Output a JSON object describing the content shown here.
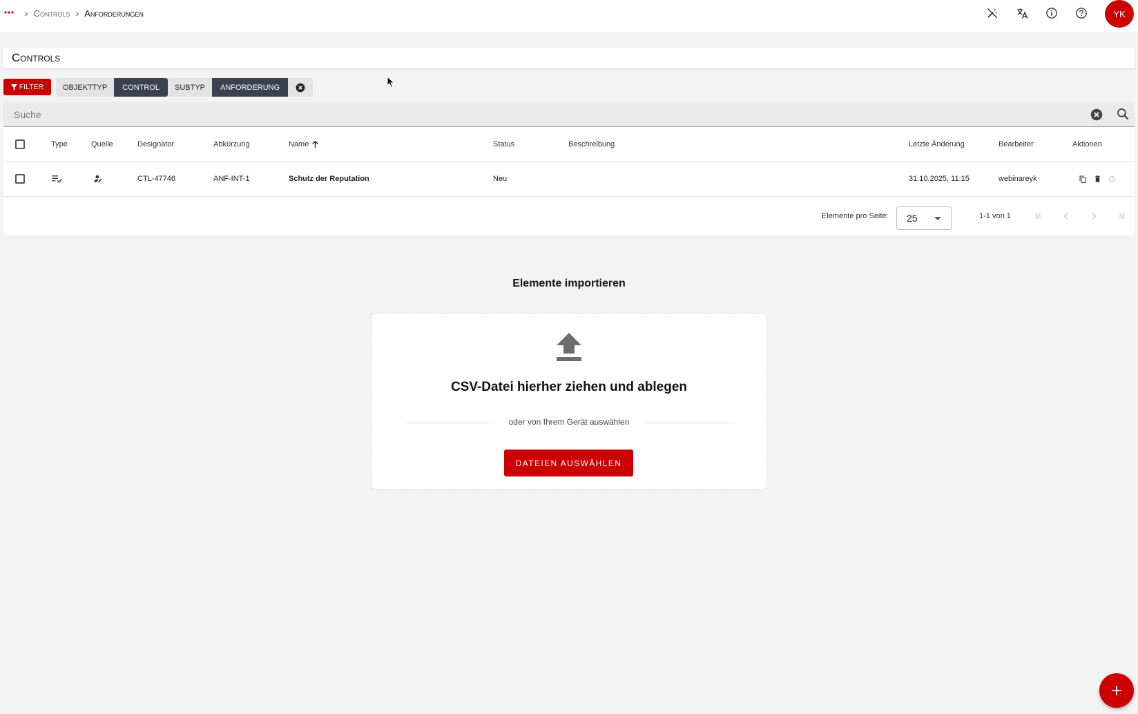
{
  "topbar": {
    "menu_icon": "more-dots-icon",
    "breadcrumb": [
      {
        "label": "Controls",
        "link": true
      },
      {
        "label": "Anforderungen",
        "link": false
      }
    ],
    "icons": [
      "auto-fix-off-icon",
      "translate-icon",
      "info-icon",
      "help-icon"
    ],
    "avatar_initials": "YK"
  },
  "page": {
    "title": "Controls"
  },
  "filters": {
    "filter_label": "FILTER",
    "chips": [
      {
        "key": "OBJEKTTYP",
        "value": "CONTROL"
      },
      {
        "key": "SUBTYP",
        "value": "ANFORDERUNG"
      }
    ]
  },
  "search": {
    "placeholder": "Suche",
    "value": ""
  },
  "table": {
    "columns": {
      "type": "Type",
      "quelle": "Quelle",
      "designator": "Designator",
      "abkuerzung": "Abkürzung",
      "name": "Name",
      "status": "Status",
      "beschreibung": "Beschreibung",
      "letzte_aenderung": "Letzte Änderung",
      "bearbeiter": "Bearbeiter",
      "aktionen": "Aktionen"
    },
    "rows": [
      {
        "type_icon": "checklist-icon",
        "quelle_icon": "person-edit-icon",
        "designator": "CTL-47746",
        "abkuerzung": "ANF-INT-1",
        "name": "Schutz der Reputation",
        "status": "Neu",
        "beschreibung": "",
        "letzte_aenderung": "31.10.2025, 11:15",
        "bearbeiter": "webinareyk"
      }
    ],
    "paginator": {
      "per_page_label": "Elemente pro Seite:",
      "per_page_value": "25",
      "range_label": "1-1 von 1"
    }
  },
  "import": {
    "title": "Elemente importieren",
    "drop_text": "CSV-Datei hierher ziehen und ablegen",
    "or_text": "oder von Ihrem Gerät auswählen",
    "button_label": "DATEIEN AUSWÄHLEN"
  },
  "colors": {
    "accent": "#cc0000",
    "chip_value_bg": "#3c4050"
  }
}
